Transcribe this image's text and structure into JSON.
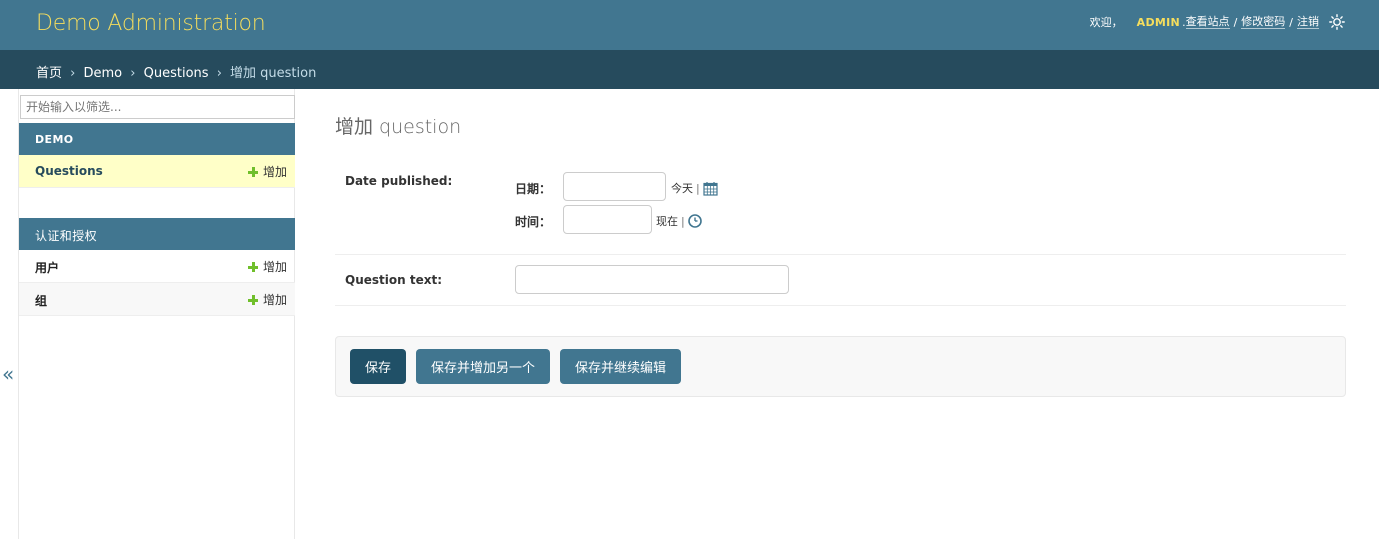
{
  "header": {
    "branding": "Demo Administration",
    "welcome": "欢迎，",
    "username": "ADMIN",
    "period": ".",
    "links": [
      "查看站点",
      "修改密码",
      "注销"
    ],
    "separator": "/",
    "theme_icon": "sun-icon"
  },
  "breadcrumbs": {
    "items": [
      "首页",
      "Demo",
      "Questions",
      "增加 question"
    ],
    "arrow": "›"
  },
  "sidebar": {
    "filter_placeholder": "开始输入以筛选...",
    "apps": [
      {
        "caption": "DEMO",
        "models": [
          {
            "name": "Questions",
            "add_label": "增加",
            "current": true
          }
        ]
      },
      {
        "caption": "认证和授权",
        "models": [
          {
            "name": "用户",
            "add_label": "增加"
          },
          {
            "name": "组",
            "add_label": "增加"
          }
        ]
      }
    ],
    "toggle_label": "«"
  },
  "content": {
    "title": "增加 question",
    "date_published": {
      "label": "Date published:",
      "date_label": "日期：",
      "date_value": "",
      "today_link": "今天",
      "time_label": "时间：",
      "time_value": "",
      "now_link": "现在",
      "pipe": "|",
      "calendar_icon": "calendar-icon",
      "clock_icon": "clock-icon"
    },
    "question_text": {
      "label": "Question text:",
      "value": ""
    }
  },
  "submit": {
    "save": "保存",
    "save_add_another": "保存并增加另一个",
    "save_continue": "保存并继续编辑"
  },
  "colors": {
    "header_bg": "#417690",
    "breadcrumb_bg": "#264b5d",
    "branding": "#f5dd5d",
    "accent_green": "#70bf2b",
    "current_row": "#ffffc8"
  }
}
